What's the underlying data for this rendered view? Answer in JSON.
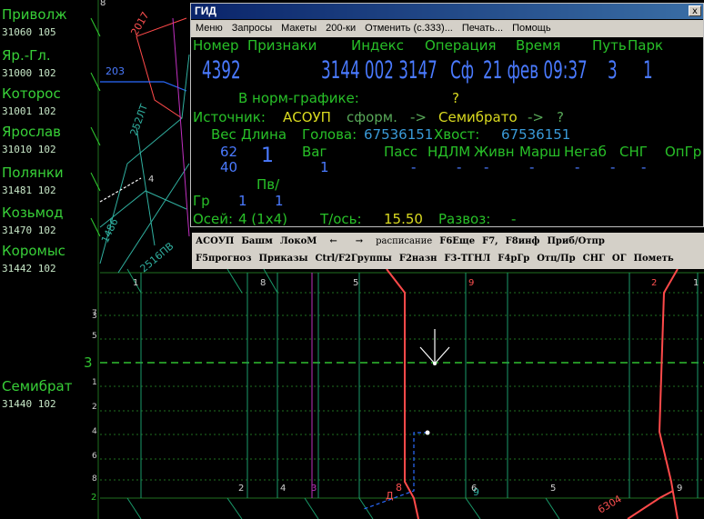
{
  "stations": [
    {
      "name": "Приволж",
      "code": "31060 105"
    },
    {
      "name": "Яр.-Гл.",
      "code": "31000 102"
    },
    {
      "name": "Которос",
      "code": "31001 102"
    },
    {
      "name": "Ярослав",
      "code": "31010 102"
    },
    {
      "name": "Полянки",
      "code": "31481 102"
    },
    {
      "name": "Козьмод",
      "code": "31470 102"
    },
    {
      "name": "Коромыс",
      "code": "31442 102"
    },
    {
      "name": "Семибрат",
      "code": "31440 102"
    }
  ],
  "track_numbers": [
    "7",
    "5",
    "3",
    "1",
    "2",
    "4",
    "6",
    "8"
  ],
  "map_labels": [
    "2017",
    "203",
    "252ЛТ",
    "1486",
    "2516ПВ",
    "6304",
    "Д",
    "8",
    "9"
  ],
  "window": {
    "title": "ГИД",
    "close": "x",
    "menu": [
      "Меню",
      "Запросы",
      "Макеты",
      "200-ки",
      "Отменить (с.333)...",
      "Печать...",
      "Помощь"
    ],
    "headers": [
      "Номер",
      "Признаки",
      "Индекс",
      "Операция",
      "Время",
      "Путь",
      "Парк"
    ],
    "number": "4392",
    "index": "3144 002 3147",
    "operation": "Сф",
    "time": "21 фев 09:37",
    "track": "3",
    "park": "1",
    "norm_label": "В норм-графике:",
    "norm_value": "?",
    "source_label": "Источник:",
    "source": "АСОУП",
    "formed": "сформ.",
    "arrow1": "->",
    "destination": "Семибрато",
    "arrow2": "->",
    "dest_q": "?",
    "weight_label": "Вес",
    "length_label": "Длина",
    "head_label": "Голова:",
    "head_value": "67536151",
    "tail_label": "Хвост:",
    "tail_value": "67536151",
    "weight_value": "62",
    "length_value": "1",
    "weight2": "40",
    "vag_label": "Ваг",
    "vag_value": "1",
    "cols": [
      "Пасс",
      "НДЛМ",
      "Живн",
      "Марш",
      "Негаб",
      "СНГ",
      "ОпГр"
    ],
    "dashes": [
      "-",
      "-",
      "-",
      "-",
      "-",
      "-",
      "-"
    ],
    "pv_label": "Пв/",
    "gr_label": "Гр",
    "gr1": "1",
    "gr2": "1",
    "axles_label": "Осей:",
    "axles_value": "4 (1х4)",
    "tonaxle_label": "Т/ось:",
    "tonaxle_value": "15.50",
    "razvoz_label": "Развоз:",
    "razvoz_value": "-"
  },
  "toolbar": {
    "row1": [
      "АСОУП",
      "Башм",
      "ЛокоМ",
      "←",
      "→",
      "расписание",
      "F6Еще",
      "F7,",
      "F8инф",
      "Приб/Отпр"
    ],
    "row2": [
      "F5прогноз",
      "Приказы",
      "Ctrl/F2Группы",
      "F2назн",
      "F3-ТГНЛ",
      "F4рГр",
      "Отц/Пр",
      "СНГ",
      "ОГ",
      "Пометь"
    ]
  },
  "colors": {
    "green": "#28c028",
    "blue": "#4a7aff",
    "red": "#ff4040",
    "magenta": "#d040d0",
    "cyan": "#20c0a0"
  }
}
